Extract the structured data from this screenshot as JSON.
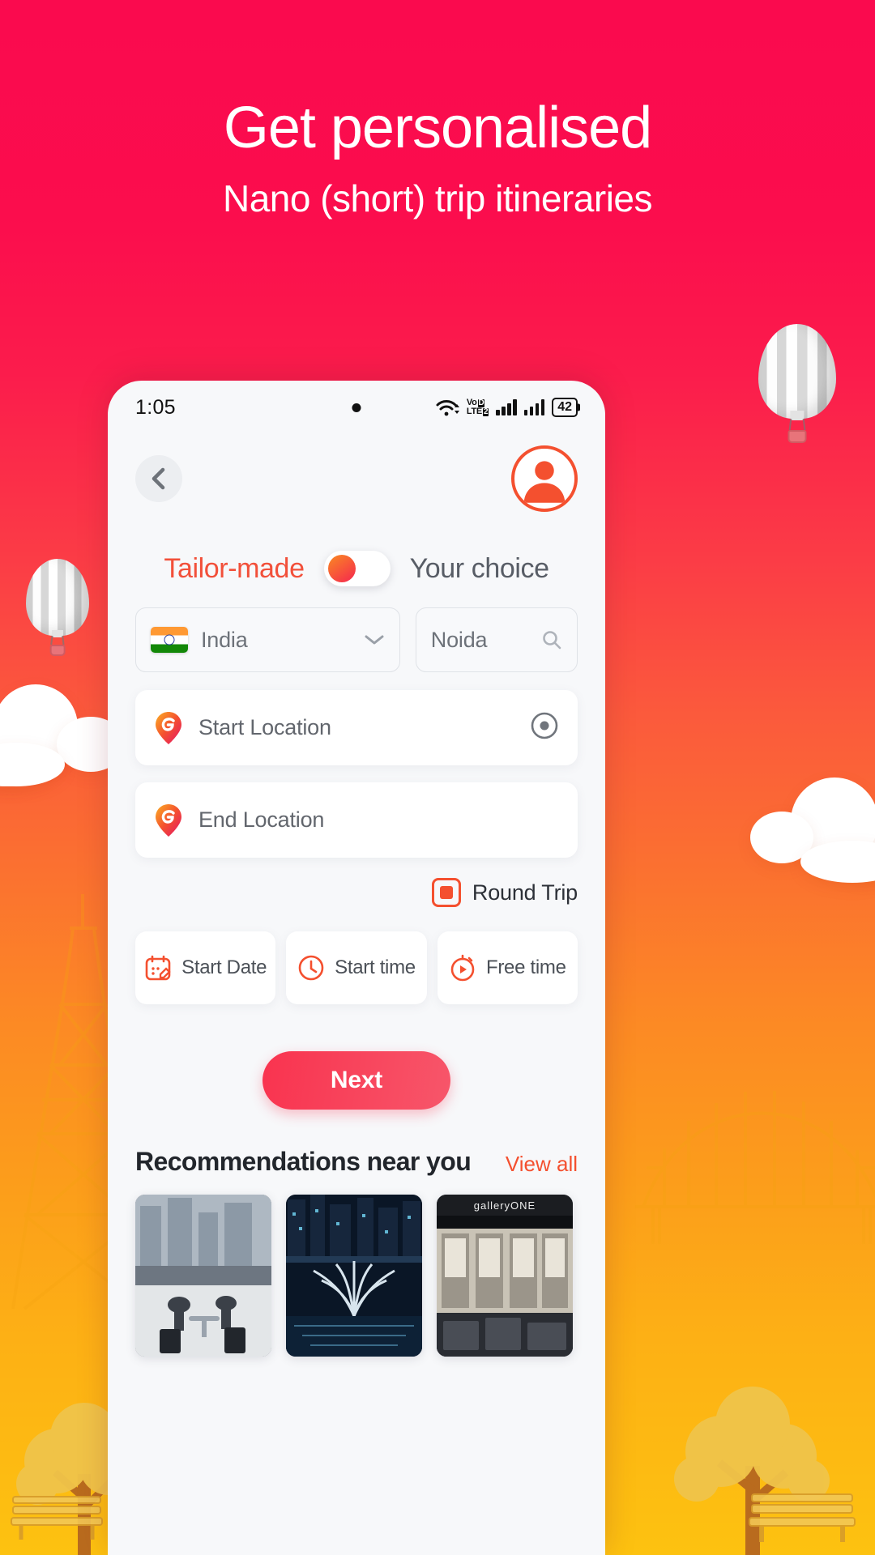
{
  "promo": {
    "headline": "Get personalised",
    "subheadline": "Nano (short) trip itineraries"
  },
  "colors": {
    "brand_pink": "#fa0a4e",
    "brand_orange": "#fdc210",
    "accent_red": "#f4502f",
    "next_button": "#f9334f",
    "toggle_knob_start": "#fa8a22",
    "toggle_knob_end": "#f5264f"
  },
  "status_bar": {
    "time": "1:05",
    "network_label_top": "Vo",
    "network_label_bottom": "LTE",
    "network_sim": "2",
    "battery_percent": "42",
    "icons": [
      "camera-punchhole-dot",
      "wifi-icon",
      "volte-icon",
      "signal-bars-icon",
      "signal-bars-icon",
      "battery-icon"
    ]
  },
  "app_header": {
    "back_icon": "chevron-left-icon",
    "avatar_icon": "user-avatar-icon"
  },
  "mode_toggle": {
    "left_label": "Tailor-made",
    "right_label": "Your choice",
    "selected": "Tailor-made",
    "state": "off"
  },
  "locale": {
    "country": "India",
    "country_flag": "flag-india-icon",
    "country_chevron": "chevron-down-icon",
    "city_placeholder": "Noida",
    "city_value": "Noida",
    "city_search_icon": "search-icon"
  },
  "route": {
    "start_placeholder": "Start Location",
    "start_value": "",
    "start_pin_icon": "g-map-pin-icon",
    "start_locate_icon": "current-location-icon",
    "end_placeholder": "End Location",
    "end_value": "",
    "end_pin_icon": "g-map-pin-icon",
    "round_trip_label": "Round Trip",
    "round_trip_checked": true
  },
  "schedule": [
    {
      "label": "Start Date",
      "icon": "calendar-edit-icon"
    },
    {
      "label": "Start time",
      "icon": "clock-icon"
    },
    {
      "label": "Free time",
      "icon": "stopwatch-play-icon"
    }
  ],
  "primary_action": {
    "label": "Next"
  },
  "recommendations": {
    "title": "Recommendations near you",
    "view_all_label": "View all",
    "cards": [
      {
        "caption": ""
      },
      {
        "caption": ""
      },
      {
        "caption": "galleryONE"
      }
    ]
  }
}
